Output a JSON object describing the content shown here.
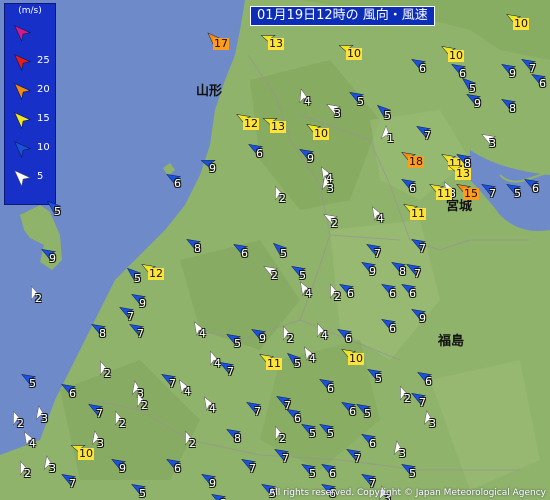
{
  "title": "01月19日12時の 風向・風速",
  "legend": {
    "unit": "(m/s)",
    "items": [
      {
        "label": "",
        "color": "#d01a8c"
      },
      {
        "label": "25",
        "color": "#e81a1a"
      },
      {
        "label": "20",
        "color": "#f28a14"
      },
      {
        "label": "15",
        "color": "#f0e620"
      },
      {
        "label": "10",
        "color": "#1a52e0"
      },
      {
        "label": "5",
        "color": "#ffffff"
      }
    ]
  },
  "places": [
    "山形",
    "宮城",
    "福島"
  ],
  "copyright": "All rights reserved. Copyright © Japan Meteorological Agency",
  "colors": {
    "sea": "#6f8ac9",
    "land": "#8fb36a",
    "white": "#ffffff",
    "blue": "#1a52e0",
    "yellow": "#f0e620",
    "orange": "#f28a14"
  },
  "observations": [
    {
      "speed": "17",
      "category": "orange",
      "dir_deg": 315
    },
    {
      "speed": "13",
      "category": "yellow",
      "dir_deg": 290
    },
    {
      "speed": "10",
      "category": "yellow",
      "dir_deg": 290
    },
    {
      "speed": "10",
      "category": "yellow",
      "dir_deg": 300
    },
    {
      "speed": "10",
      "category": "yellow",
      "dir_deg": 300
    },
    {
      "speed": "6",
      "category": "blue",
      "dir_deg": 300
    },
    {
      "speed": "5",
      "category": "blue",
      "dir_deg": 310
    },
    {
      "speed": "9",
      "category": "blue",
      "dir_deg": 300
    },
    {
      "speed": "4",
      "category": "white",
      "dir_deg": 345
    },
    {
      "speed": "5",
      "category": "blue",
      "dir_deg": 300
    },
    {
      "speed": "3",
      "category": "white",
      "dir_deg": 300
    },
    {
      "speed": "12",
      "category": "yellow",
      "dir_deg": 300
    },
    {
      "speed": "13",
      "category": "yellow",
      "dir_deg": 290
    },
    {
      "speed": "10",
      "category": "yellow",
      "dir_deg": 300
    },
    {
      "speed": "5",
      "category": "blue",
      "dir_deg": 310
    },
    {
      "speed": "1",
      "category": "white",
      "dir_deg": 0
    },
    {
      "speed": "7",
      "category": "blue",
      "dir_deg": 300
    },
    {
      "speed": "9",
      "category": "blue",
      "dir_deg": 300
    },
    {
      "speed": "6",
      "category": "blue",
      "dir_deg": 300
    },
    {
      "speed": "7",
      "category": "blue",
      "dir_deg": 300
    },
    {
      "speed": "8",
      "category": "blue",
      "dir_deg": 300
    },
    {
      "speed": "6",
      "category": "blue",
      "dir_deg": 300
    },
    {
      "speed": "9",
      "category": "blue",
      "dir_deg": 300
    },
    {
      "speed": "9",
      "category": "blue",
      "dir_deg": 290
    },
    {
      "speed": "6",
      "category": "blue",
      "dir_deg": 300
    },
    {
      "speed": "4",
      "category": "white",
      "dir_deg": 330
    },
    {
      "speed": "3",
      "category": "white",
      "dir_deg": 300
    },
    {
      "speed": "18",
      "category": "orange",
      "dir_deg": 300
    },
    {
      "speed": "11",
      "category": "yellow",
      "dir_deg": 300
    },
    {
      "speed": "3",
      "category": "white",
      "dir_deg": 330
    },
    {
      "speed": "6",
      "category": "blue",
      "dir_deg": 300
    },
    {
      "speed": "7",
      "category": "blue",
      "dir_deg": 300
    },
    {
      "speed": "11",
      "category": "yellow",
      "dir_deg": 300
    },
    {
      "speed": "15",
      "category": "orange",
      "dir_deg": 300
    },
    {
      "speed": "8",
      "category": "blue",
      "dir_deg": 300
    },
    {
      "speed": "5",
      "category": "blue",
      "dir_deg": 300
    },
    {
      "speed": "6",
      "category": "blue",
      "dir_deg": 300
    },
    {
      "speed": "11",
      "category": "yellow",
      "dir_deg": 300
    },
    {
      "speed": "13",
      "category": "yellow",
      "dir_deg": 290
    },
    {
      "speed": "7",
      "category": "blue",
      "dir_deg": 300
    },
    {
      "speed": "4",
      "category": "white",
      "dir_deg": 330
    },
    {
      "speed": "2",
      "category": "white",
      "dir_deg": 340
    },
    {
      "speed": "3",
      "category": "white",
      "dir_deg": 350
    },
    {
      "speed": "2",
      "category": "white",
      "dir_deg": 300
    },
    {
      "speed": "6",
      "category": "blue",
      "dir_deg": 300
    },
    {
      "speed": "5",
      "category": "blue",
      "dir_deg": 310
    },
    {
      "speed": "9",
      "category": "blue",
      "dir_deg": 300
    },
    {
      "speed": "2",
      "category": "white",
      "dir_deg": 340
    },
    {
      "speed": "7",
      "category": "blue",
      "dir_deg": 300
    },
    {
      "speed": "12",
      "category": "yellow",
      "dir_deg": 300
    },
    {
      "speed": "8",
      "category": "blue",
      "dir_deg": 300
    },
    {
      "speed": "6",
      "category": "blue",
      "dir_deg": 300
    },
    {
      "speed": "5",
      "category": "blue",
      "dir_deg": 310
    },
    {
      "speed": "2",
      "category": "white",
      "dir_deg": 300
    },
    {
      "speed": "5",
      "category": "blue",
      "dir_deg": 300
    },
    {
      "speed": "4",
      "category": "white",
      "dir_deg": 330
    },
    {
      "speed": "6",
      "category": "blue",
      "dir_deg": 300
    },
    {
      "speed": "9",
      "category": "blue",
      "dir_deg": 300
    },
    {
      "speed": "8",
      "category": "blue",
      "dir_deg": 300
    },
    {
      "speed": "6",
      "category": "blue",
      "dir_deg": 300
    },
    {
      "speed": "2",
      "category": "white",
      "dir_deg": 340
    },
    {
      "speed": "6",
      "category": "blue",
      "dir_deg": 300
    },
    {
      "speed": "7",
      "category": "blue",
      "dir_deg": 300
    },
    {
      "speed": "5",
      "category": "blue",
      "dir_deg": 310
    },
    {
      "speed": "9",
      "category": "blue",
      "dir_deg": 300
    },
    {
      "speed": "7",
      "category": "blue",
      "dir_deg": 300
    },
    {
      "speed": "7",
      "category": "blue",
      "dir_deg": 300
    },
    {
      "speed": "8",
      "category": "blue",
      "dir_deg": 300
    },
    {
      "speed": "4",
      "category": "white",
      "dir_deg": 330
    },
    {
      "speed": "5",
      "category": "blue",
      "dir_deg": 300
    },
    {
      "speed": "9",
      "category": "blue",
      "dir_deg": 300
    },
    {
      "speed": "2",
      "category": "white",
      "dir_deg": 340
    },
    {
      "speed": "4",
      "category": "white",
      "dir_deg": 340
    },
    {
      "speed": "6",
      "category": "blue",
      "dir_deg": 300
    },
    {
      "speed": "6",
      "category": "blue",
      "dir_deg": 300
    },
    {
      "speed": "9",
      "category": "blue",
      "dir_deg": 300
    },
    {
      "speed": "4",
      "category": "white",
      "dir_deg": 340
    },
    {
      "speed": "7",
      "category": "blue",
      "dir_deg": 300
    },
    {
      "speed": "5",
      "category": "blue",
      "dir_deg": 310
    },
    {
      "speed": "4",
      "category": "white",
      "dir_deg": 330
    },
    {
      "speed": "10",
      "category": "yellow",
      "dir_deg": 300
    },
    {
      "speed": "11",
      "category": "yellow",
      "dir_deg": 300
    },
    {
      "speed": "6",
      "category": "blue",
      "dir_deg": 300
    },
    {
      "speed": "5",
      "category": "blue",
      "dir_deg": 300
    },
    {
      "speed": "2",
      "category": "white",
      "dir_deg": 340
    },
    {
      "speed": "7",
      "category": "blue",
      "dir_deg": 300
    },
    {
      "speed": "5",
      "category": "blue",
      "dir_deg": 300
    },
    {
      "speed": "6",
      "category": "blue",
      "dir_deg": 300
    },
    {
      "speed": "3",
      "category": "white",
      "dir_deg": 350
    },
    {
      "speed": "4",
      "category": "white",
      "dir_deg": 330
    },
    {
      "speed": "2",
      "category": "white",
      "dir_deg": 340
    },
    {
      "speed": "7",
      "category": "blue",
      "dir_deg": 300
    },
    {
      "speed": "7",
      "category": "blue",
      "dir_deg": 300
    },
    {
      "speed": "6",
      "category": "blue",
      "dir_deg": 300
    },
    {
      "speed": "5",
      "category": "blue",
      "dir_deg": 300
    },
    {
      "speed": "6",
      "category": "blue",
      "dir_deg": 300
    },
    {
      "speed": "7",
      "category": "blue",
      "dir_deg": 300
    },
    {
      "speed": "3",
      "category": "white",
      "dir_deg": 350
    },
    {
      "speed": "2",
      "category": "white",
      "dir_deg": 340
    },
    {
      "speed": "7",
      "category": "blue",
      "dir_deg": 300
    },
    {
      "speed": "2",
      "category": "white",
      "dir_deg": 340
    },
    {
      "speed": "4",
      "category": "white",
      "dir_deg": 330
    },
    {
      "speed": "6",
      "category": "blue",
      "dir_deg": 300
    },
    {
      "speed": "2",
      "category": "white",
      "dir_deg": 340
    },
    {
      "speed": "3",
      "category": "white",
      "dir_deg": 350
    },
    {
      "speed": "5",
      "category": "blue",
      "dir_deg": 300
    },
    {
      "speed": "8",
      "category": "blue",
      "dir_deg": 300
    },
    {
      "speed": "2",
      "category": "white",
      "dir_deg": 340
    },
    {
      "speed": "7",
      "category": "blue",
      "dir_deg": 300
    },
    {
      "speed": "6",
      "category": "blue",
      "dir_deg": 300
    },
    {
      "speed": "3",
      "category": "white",
      "dir_deg": 350
    },
    {
      "speed": "4",
      "category": "white",
      "dir_deg": 330
    },
    {
      "speed": "3",
      "category": "white",
      "dir_deg": 350
    },
    {
      "speed": "2",
      "category": "white",
      "dir_deg": 340
    },
    {
      "speed": "7",
      "category": "blue",
      "dir_deg": 300
    },
    {
      "speed": "5",
      "category": "blue",
      "dir_deg": 300
    },
    {
      "speed": "6",
      "category": "blue",
      "dir_deg": 300
    },
    {
      "speed": "5",
      "category": "blue",
      "dir_deg": 300
    },
    {
      "speed": "3",
      "category": "white",
      "dir_deg": 350
    },
    {
      "speed": "9",
      "category": "blue",
      "dir_deg": 300
    },
    {
      "speed": "6",
      "category": "blue",
      "dir_deg": 300
    },
    {
      "speed": "5",
      "category": "blue",
      "dir_deg": 300
    },
    {
      "speed": "7",
      "category": "blue",
      "dir_deg": 300
    },
    {
      "speed": "2",
      "category": "white",
      "dir_deg": 340
    },
    {
      "speed": "3",
      "category": "white",
      "dir_deg": 350
    },
    {
      "speed": "10",
      "category": "yellow",
      "dir_deg": 290
    },
    {
      "speed": "9",
      "category": "blue",
      "dir_deg": 300
    },
    {
      "speed": "6",
      "category": "blue",
      "dir_deg": 300
    },
    {
      "speed": "5",
      "category": "blue",
      "dir_deg": 300
    },
    {
      "speed": "7",
      "category": "blue",
      "dir_deg": 300
    },
    {
      "speed": "6",
      "category": "blue",
      "dir_deg": 300
    },
    {
      "speed": "5",
      "category": "blue",
      "dir_deg": 300
    },
    {
      "speed": "7",
      "category": "blue",
      "dir_deg": 300
    },
    {
      "speed": "6",
      "category": "blue",
      "dir_deg": 300
    },
    {
      "speed": "8",
      "category": "blue",
      "dir_deg": 300
    },
    {
      "speed": "3",
      "category": "white",
      "dir_deg": 340
    },
    {
      "speed": "2",
      "category": "white",
      "dir_deg": 340
    },
    {
      "speed": "3",
      "category": "white",
      "dir_deg": 350
    }
  ]
}
